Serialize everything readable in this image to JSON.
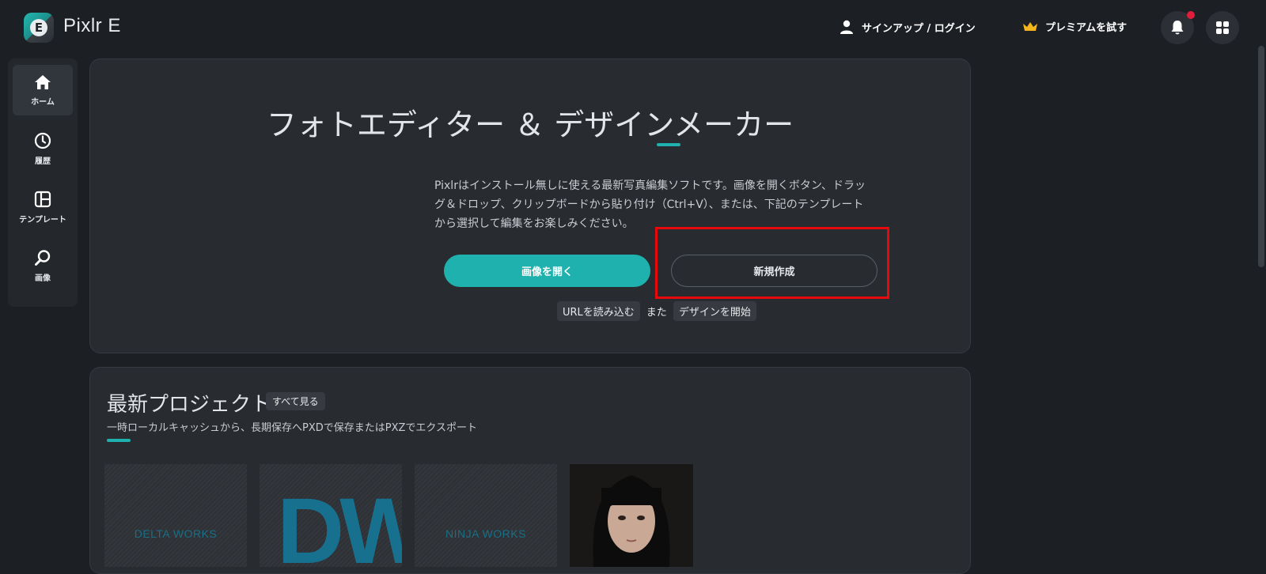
{
  "app": {
    "title": "Pixlr E",
    "logo_letter": "E"
  },
  "header": {
    "signin_label": "サインアップ / ログイン",
    "premium_label": "プレミアムを試す",
    "accent_color": "#1eb1ad"
  },
  "sidebar": {
    "items": [
      {
        "label": "ホーム",
        "icon": "home-icon",
        "active": true
      },
      {
        "label": "履歴",
        "icon": "clock-icon",
        "active": false
      },
      {
        "label": "テンプレート",
        "icon": "template-icon",
        "active": false
      },
      {
        "label": "画像",
        "icon": "search-icon",
        "active": false
      }
    ]
  },
  "hero": {
    "title": "フォトエディター ＆ デザインメーカー",
    "description_lines": [
      "Pixlrはインストール無しに使える最新写真編集ソフトです。画像を開くボタン、ドラッ",
      "グ＆ドロップ、クリップボードから貼り付け（Ctrl+V）、または、下記のテンプレート",
      "から選択して編集をお楽しみください。"
    ],
    "open_image_label": "画像を開く",
    "new_label": "新規作成",
    "load_url_label": "URLを読み込む",
    "or_label": "また",
    "start_design_label": "デザインを開始"
  },
  "projects": {
    "title": "最新プロジェクト",
    "see_all_label": "すべて見る",
    "subtitle": "一時ローカルキャッシュから、長期保存へPXDで保存またはPXZでエクスポート",
    "thumbnails": [
      {
        "text": "DELTA WORKS"
      },
      {
        "text": "DW"
      },
      {
        "text": "NINJA WORKS"
      },
      {
        "text": ""
      }
    ]
  }
}
